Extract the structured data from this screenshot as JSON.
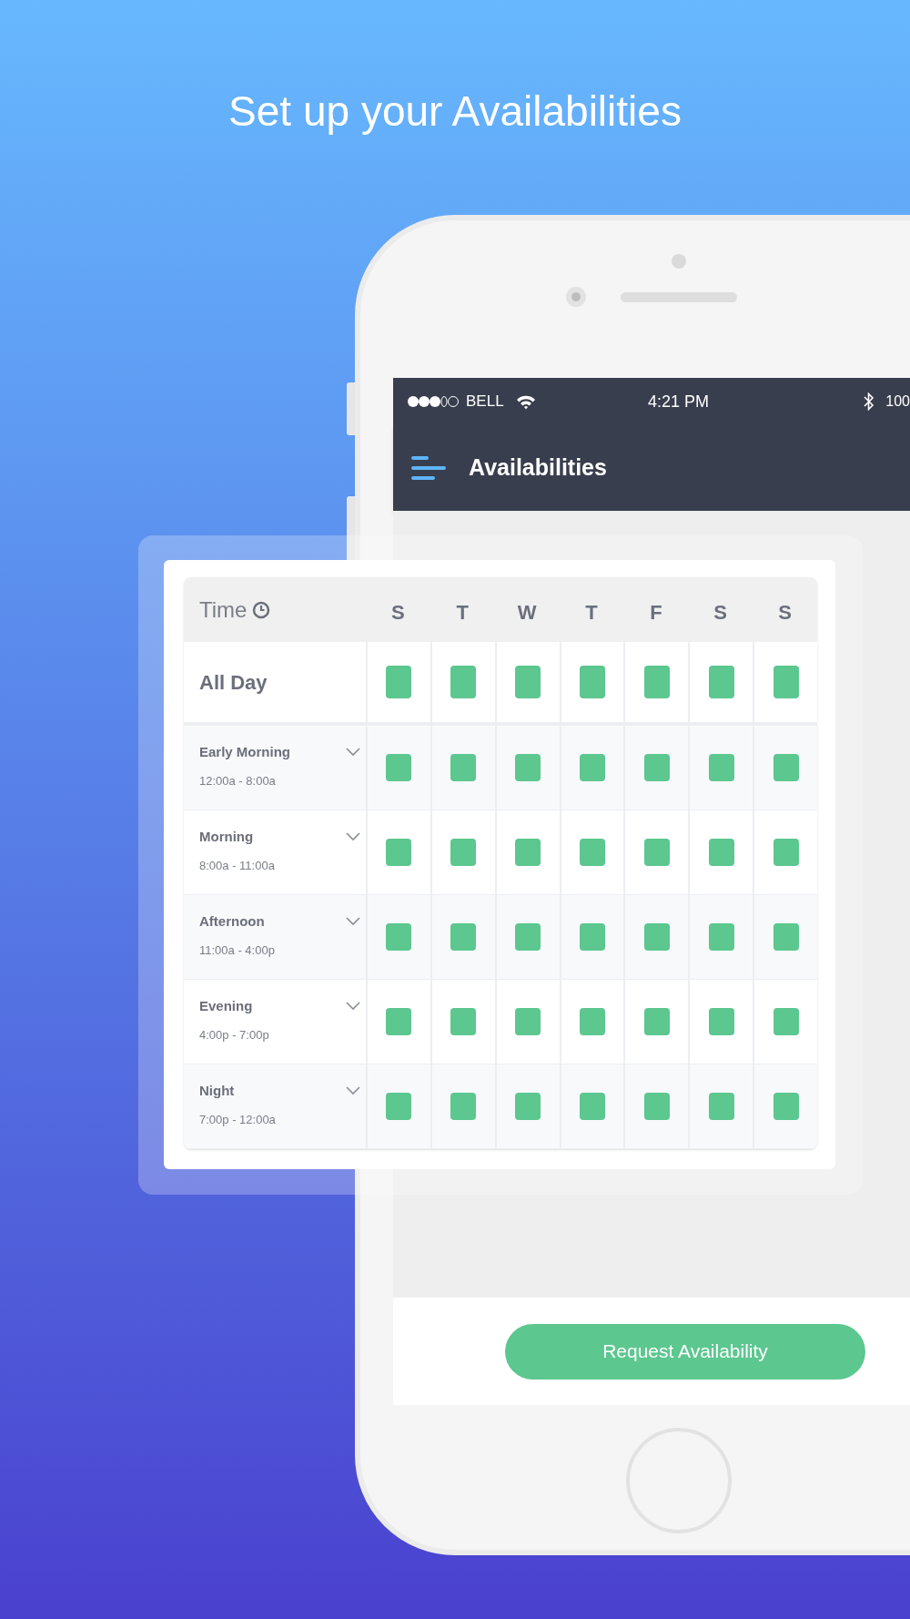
{
  "headline": "Set up your Availabilities",
  "status_bar": {
    "carrier": "BELL",
    "time": "4:21 PM",
    "battery": "100"
  },
  "nav": {
    "title": "Availabilities"
  },
  "table": {
    "time_label": "Time",
    "days": [
      "S",
      "T",
      "W",
      "T",
      "F",
      "S",
      "S"
    ],
    "rows": [
      {
        "kind": "all_day",
        "label": "All Day",
        "slots": [
          {
            "available": true
          },
          {
            "available": true
          },
          {
            "available": true
          },
          {
            "available": true
          },
          {
            "available": true
          },
          {
            "available": true
          },
          {
            "available": true
          }
        ]
      },
      {
        "kind": "period",
        "label": "Early Morning",
        "range": "12:00a - 8:00a",
        "slots": [
          {
            "available": true
          },
          {
            "available": true
          },
          {
            "available": true
          },
          {
            "available": true
          },
          {
            "available": true
          },
          {
            "available": true
          },
          {
            "available": true
          }
        ]
      },
      {
        "kind": "period",
        "label": "Morning",
        "range": "8:00a - 11:00a",
        "slots": [
          {
            "available": true
          },
          {
            "available": true
          },
          {
            "available": true
          },
          {
            "available": true
          },
          {
            "available": true
          },
          {
            "available": true
          },
          {
            "available": true
          }
        ]
      },
      {
        "kind": "period",
        "label": "Afternoon",
        "range": "11:00a - 4:00p",
        "slots": [
          {
            "available": true
          },
          {
            "available": true
          },
          {
            "available": true
          },
          {
            "available": true
          },
          {
            "available": true
          },
          {
            "available": true
          },
          {
            "available": true
          }
        ]
      },
      {
        "kind": "period",
        "label": "Evening",
        "range": "4:00p - 7:00p",
        "slots": [
          {
            "available": true
          },
          {
            "available": true
          },
          {
            "available": true
          },
          {
            "available": true
          },
          {
            "available": true
          },
          {
            "available": true
          },
          {
            "available": true
          }
        ]
      },
      {
        "kind": "period",
        "label": "Night",
        "range": "7:00p - 12:00a",
        "slots": [
          {
            "available": true
          },
          {
            "available": true
          },
          {
            "available": true
          },
          {
            "available": true
          },
          {
            "available": true
          },
          {
            "available": true
          },
          {
            "available": true
          }
        ]
      }
    ]
  },
  "button": {
    "label": "Request Availability"
  }
}
